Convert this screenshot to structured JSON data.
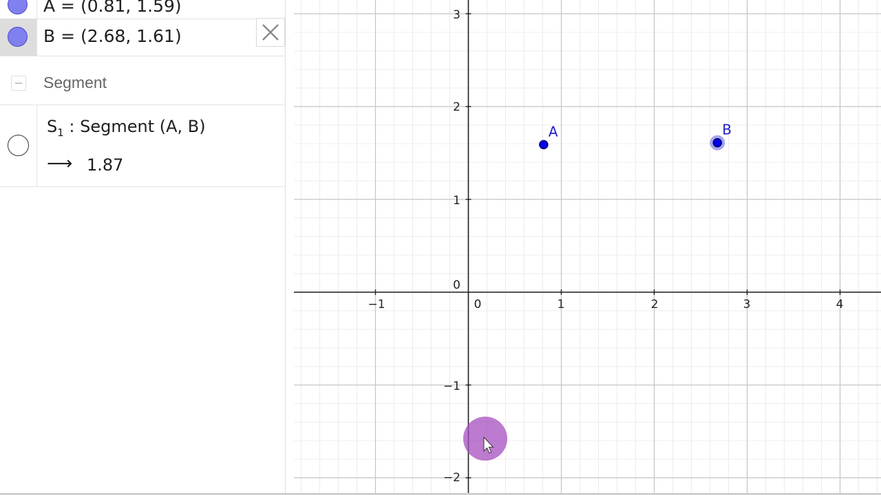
{
  "algebra": {
    "point_a": {
      "definition": "A = (0.81, 1.59)"
    },
    "point_b": {
      "definition": "B = (2.68, 1.61)"
    },
    "group": {
      "label": "Segment"
    },
    "segment": {
      "name": "S",
      "subscript": "1",
      "definition": ": Segment (A, B)",
      "arrow": "⟶",
      "value": "1.87"
    },
    "close_icon": "close-icon",
    "collapse_icon": "minus-icon"
  },
  "graphics": {
    "x_ticks": [
      "−1",
      "0",
      "1",
      "2",
      "3",
      "4"
    ],
    "y_ticks": [
      "3",
      "2",
      "1",
      "0",
      "−1",
      "−2"
    ],
    "points": [
      {
        "label": "A",
        "x": 0.81,
        "y": 1.59,
        "selected": false
      },
      {
        "label": "B",
        "x": 2.68,
        "y": 1.61,
        "selected": true
      }
    ],
    "grid": true,
    "colors": {
      "point": "#0000ee",
      "point_outline": "#000066",
      "selection_halo": "#8a8ae6",
      "label": "#1a1acc",
      "cursor_highlight": "#a64fbf"
    }
  }
}
